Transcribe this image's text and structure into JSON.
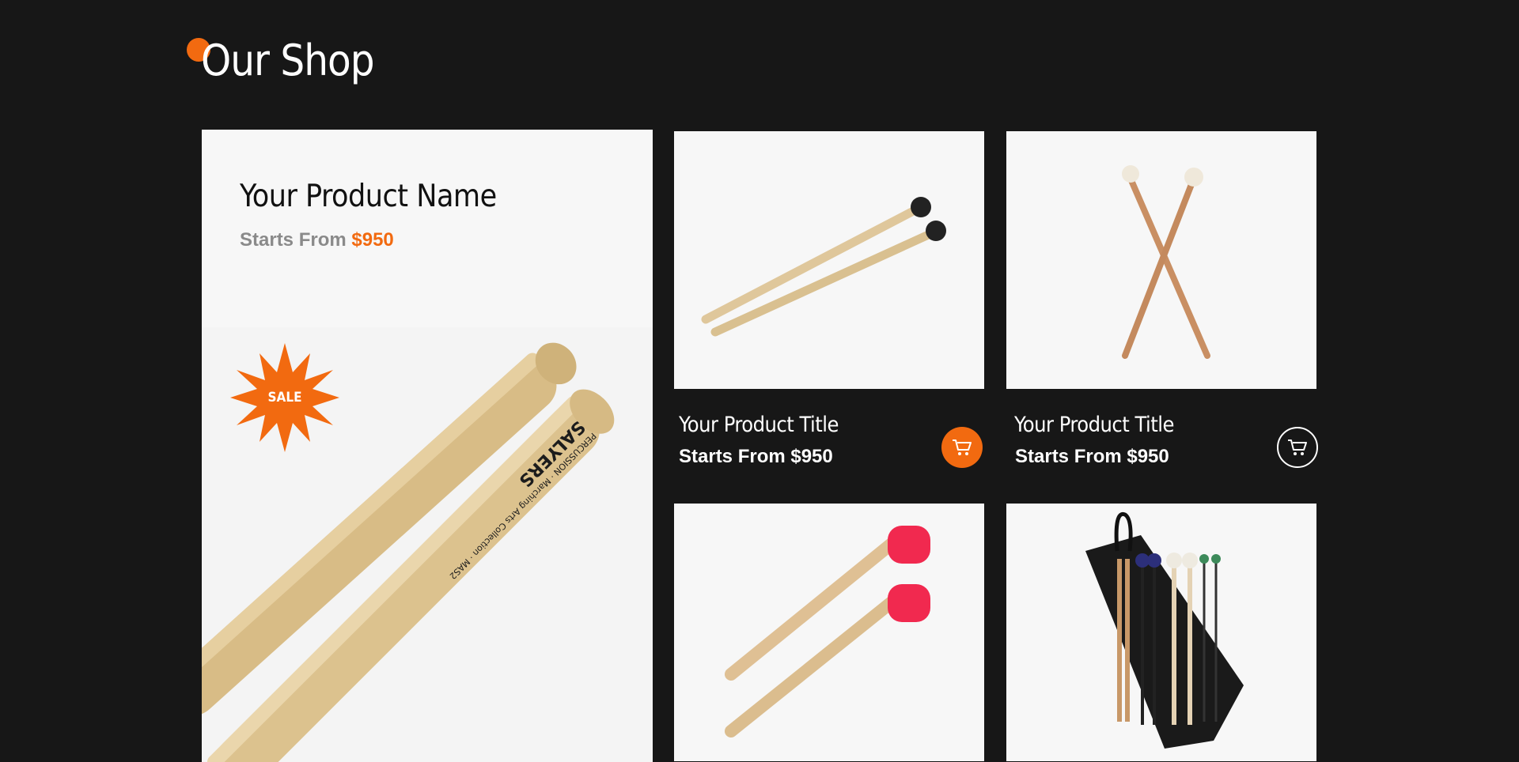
{
  "page": {
    "title": "Our Shop"
  },
  "featured": {
    "name": "Your Product Name",
    "price_prefix": "Starts From",
    "price": "$950",
    "badge": "SALE",
    "image_icon": "drumsticks-image"
  },
  "products": [
    {
      "title": "Your Product Title",
      "price_label": "Starts From $950",
      "cart_icon": "cart-icon",
      "cart_style": "filled",
      "image_icon": "mallets-black-image"
    },
    {
      "title": "Your Product Title",
      "price_label": "Starts From $950",
      "cart_icon": "cart-icon",
      "cart_style": "outline",
      "image_icon": "mallets-felt-crossed-image"
    },
    {
      "image_icon": "mallets-red-image"
    },
    {
      "image_icon": "stick-bag-image"
    }
  ],
  "colors": {
    "background": "#171717",
    "accent": "#f26a10",
    "card": "#f7f7f7",
    "text_light": "#ffffff",
    "text_muted": "#8a8a8a"
  }
}
